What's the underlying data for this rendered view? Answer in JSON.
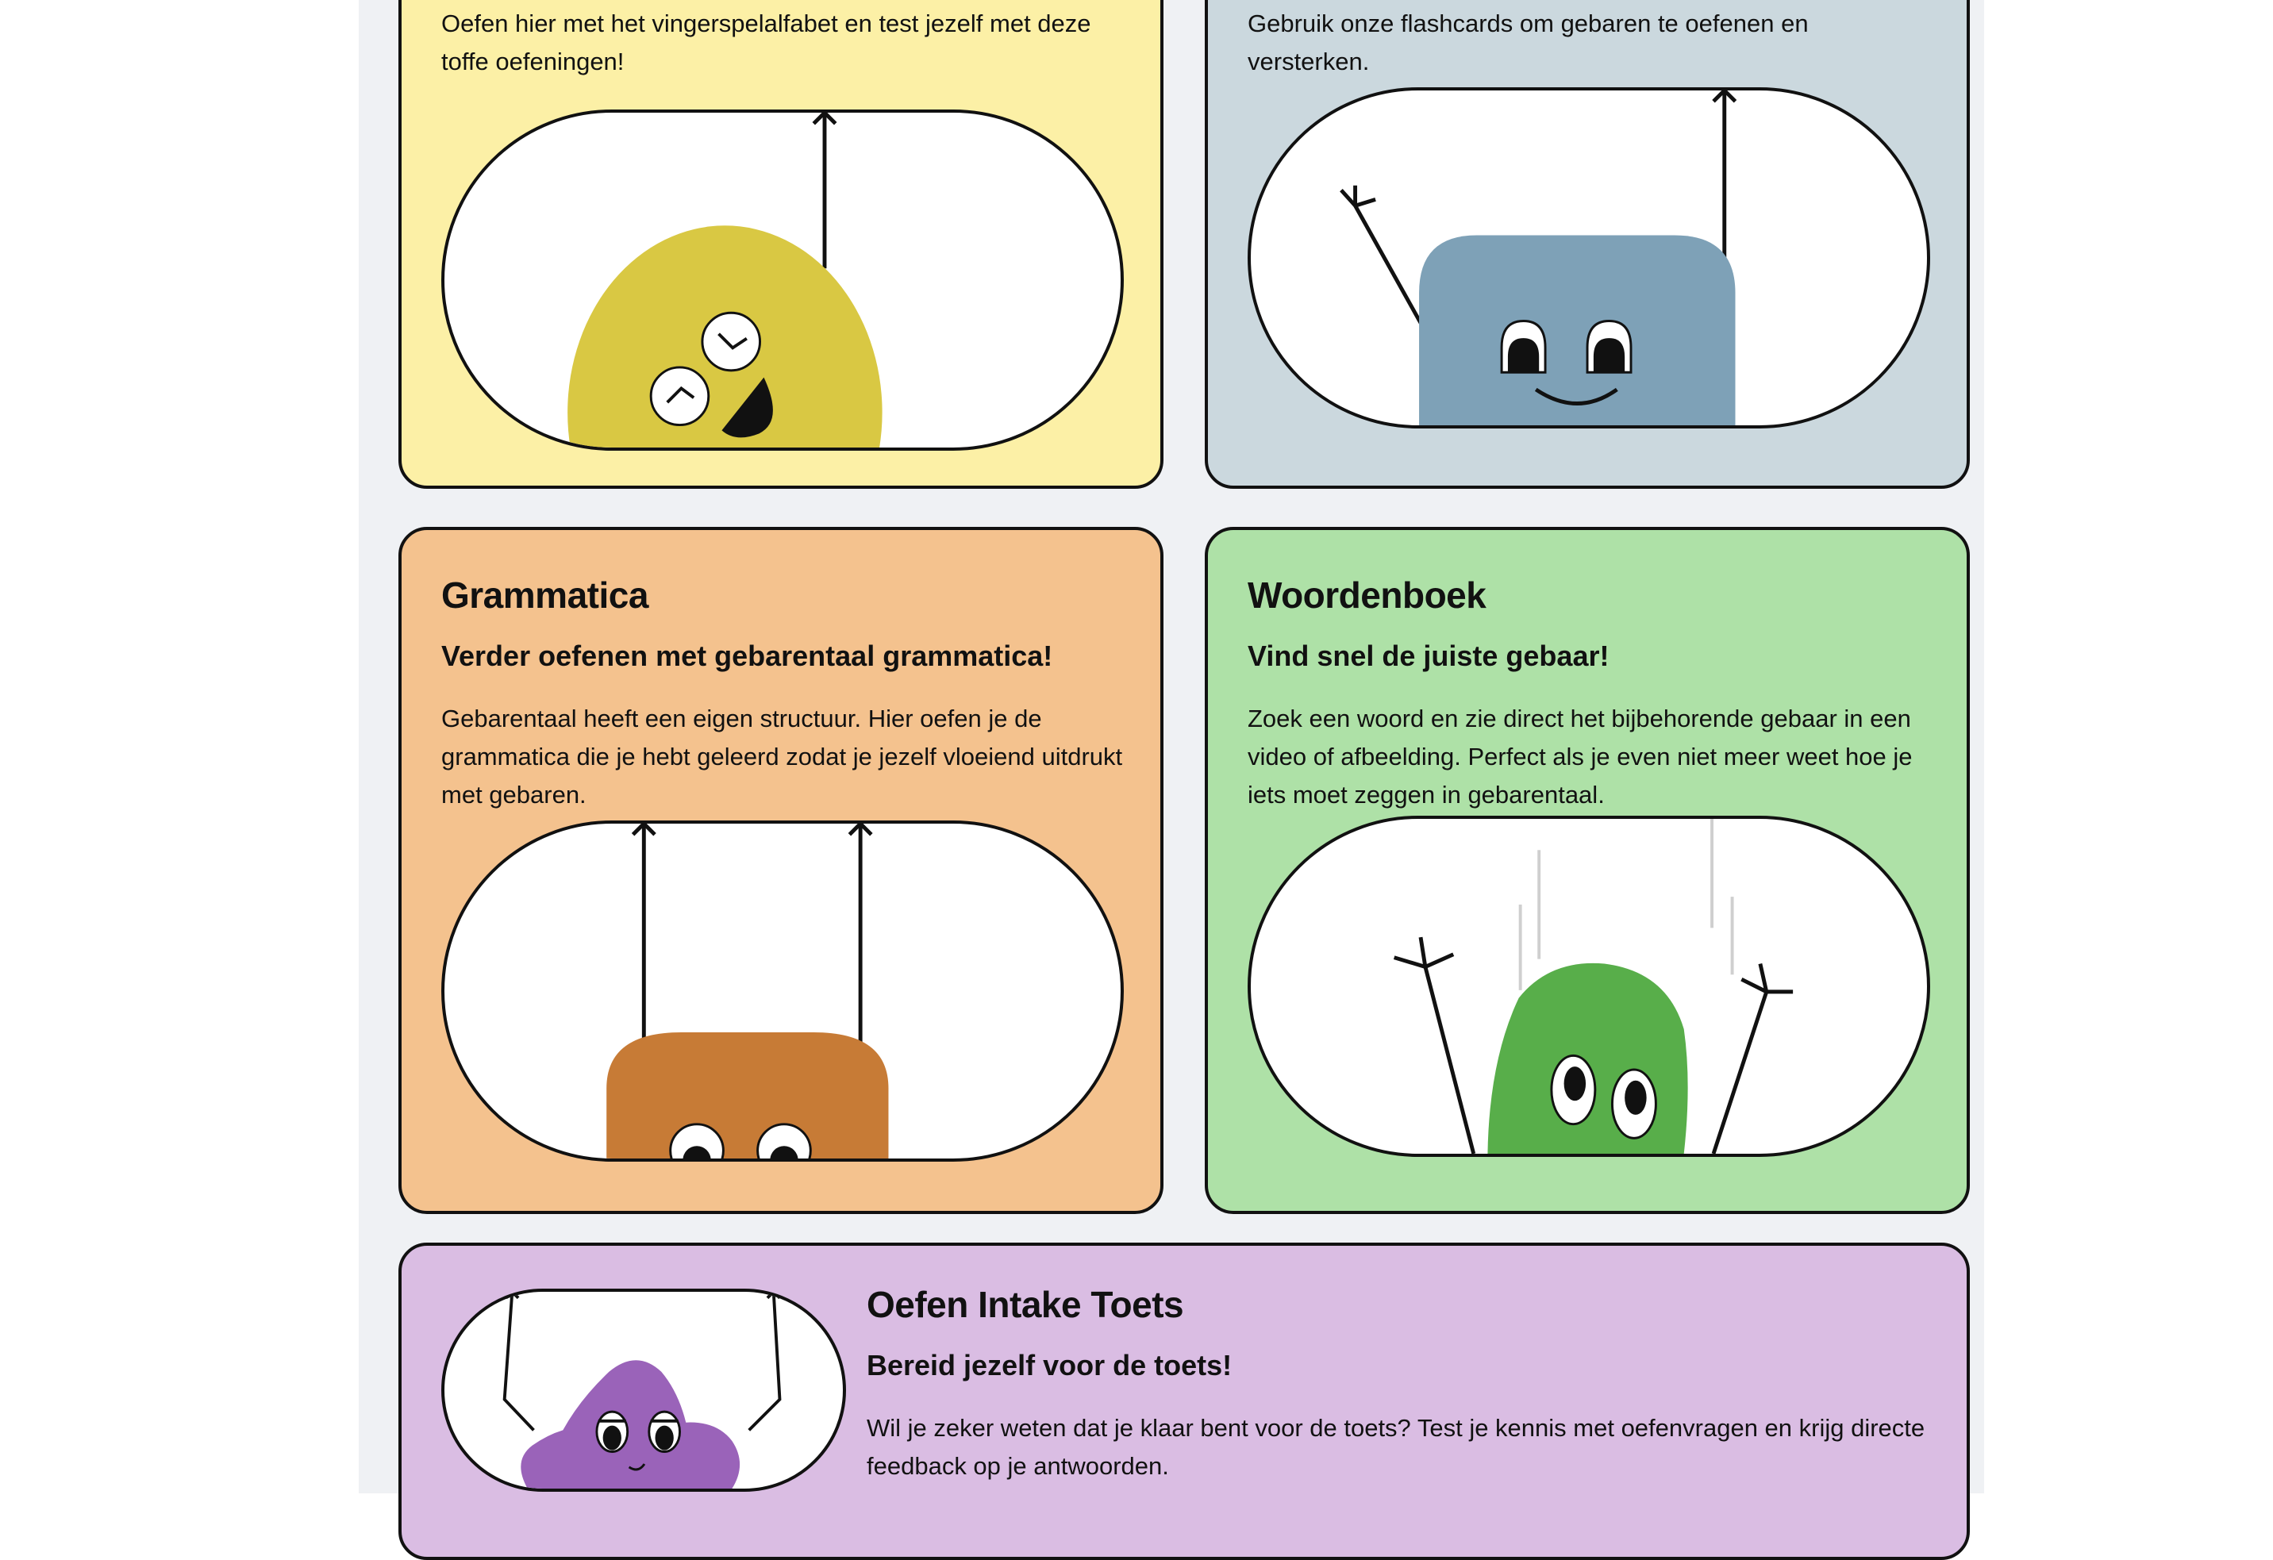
{
  "colors": {
    "page_background": "#eff1f4",
    "yellow_card": "#fcf0a6",
    "blue_card": "#cbd8de",
    "orange_card": "#f4c28e",
    "green_card": "#aee1a7",
    "purple_card": "#dabde3",
    "border": "#111111"
  },
  "cards": {
    "fingerspelling": {
      "description": "Oefen hier met het vingerspelalfabet en test jezelf met deze toffe oefeningen!"
    },
    "flashcards": {
      "description": "Gebruik onze flashcards om gebaren te oefenen en versterken."
    },
    "grammar": {
      "title": "Grammatica",
      "subtitle": "Verder oefenen met gebarentaal grammatica!",
      "description": "Gebarentaal heeft een eigen structuur. Hier oefen je de grammatica die je hebt geleerd zodat je jezelf vloeiend uitdrukt met gebaren."
    },
    "dictionary": {
      "title": "Woordenboek",
      "subtitle": "Vind snel de juiste gebaar!",
      "description": "Zoek een woord en zie direct het bijbehorende gebaar in een video of afbeelding. Perfect als je even niet meer weet hoe je iets moet zeggen in gebarentaal."
    },
    "intake": {
      "title": "Oefen Intake Toets",
      "subtitle": "Bereid jezelf voor de toets!",
      "description": "Wil je zeker weten dat je klaar bent voor de toets? Test je kennis met oefenvragen en krijg directe feedback op je antwoorden."
    }
  },
  "illustrations": {
    "fingerspelling": "yellow-laughing-character-icon",
    "flashcards": "blue-waving-character-icon",
    "grammar": "orange-hanging-character-icon",
    "dictionary": "green-cheering-character-icon",
    "intake": "purple-hanging-character-icon"
  }
}
